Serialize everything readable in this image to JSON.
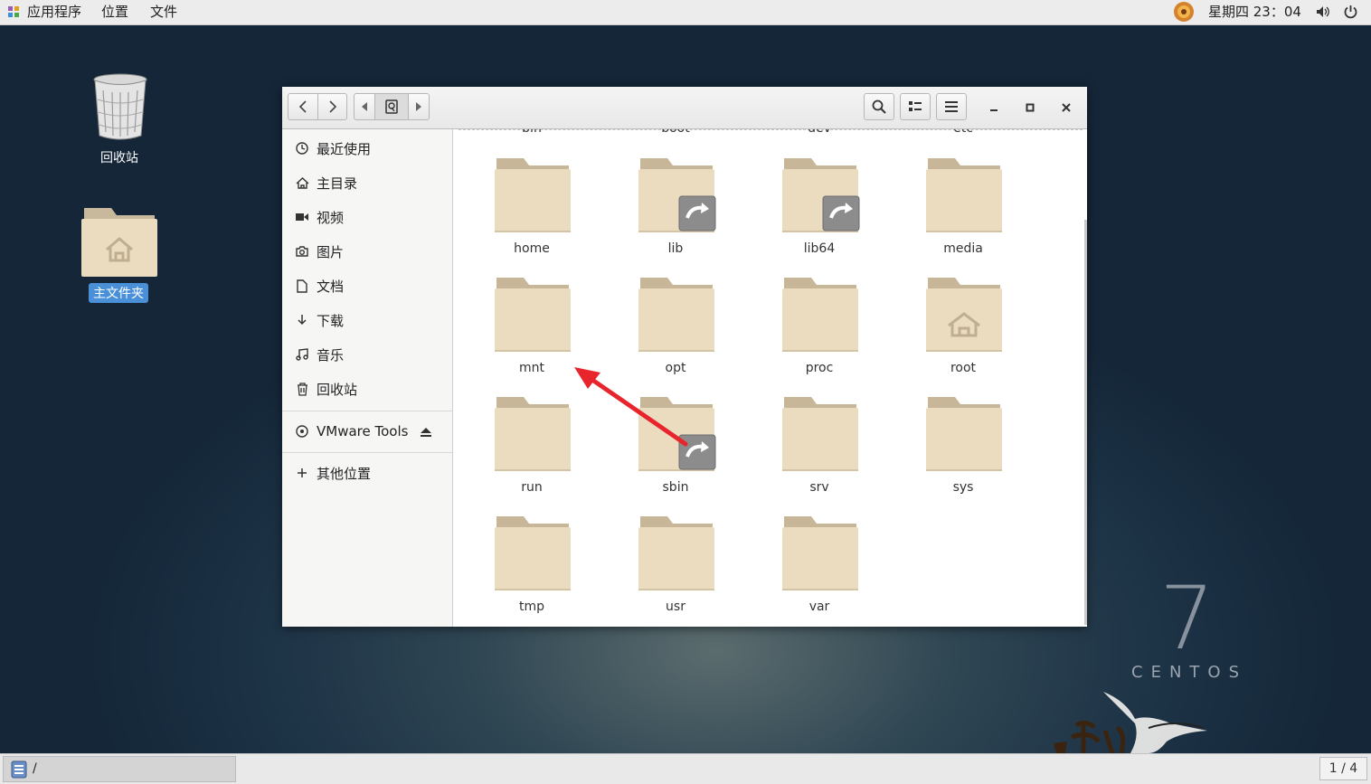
{
  "topbar": {
    "menus": [
      "应用程序",
      "位置",
      "文件"
    ],
    "clock": "星期四 23：04"
  },
  "desktop": {
    "icons": [
      {
        "label": "回收站",
        "icon": "trash-icon"
      },
      {
        "label": "主文件夹",
        "icon": "home-folder-icon",
        "selected": true
      }
    ],
    "branding": {
      "number": "7",
      "word": "CENTOS"
    }
  },
  "window": {
    "sidebar": {
      "items": [
        {
          "label": "最近使用",
          "icon": "recent-icon"
        },
        {
          "label": "主目录",
          "icon": "home-icon"
        },
        {
          "label": "视频",
          "icon": "video-icon"
        },
        {
          "label": "图片",
          "icon": "camera-icon"
        },
        {
          "label": "文档",
          "icon": "document-icon"
        },
        {
          "label": "下载",
          "icon": "download-icon"
        },
        {
          "label": "音乐",
          "icon": "music-icon"
        },
        {
          "label": "回收站",
          "icon": "trash-icon"
        }
      ],
      "device": {
        "label": "VMware Tools",
        "icon": "disc-icon",
        "eject_icon": "eject-icon"
      },
      "other": {
        "label": "其他位置",
        "icon": "plus-icon"
      }
    },
    "content": {
      "cut_off_row": [
        "bin",
        "boot",
        "dev",
        "etc"
      ],
      "items": [
        {
          "name": "home",
          "type": "folder"
        },
        {
          "name": "lib",
          "type": "symlink"
        },
        {
          "name": "lib64",
          "type": "symlink"
        },
        {
          "name": "media",
          "type": "folder"
        },
        {
          "name": "mnt",
          "type": "folder"
        },
        {
          "name": "opt",
          "type": "folder"
        },
        {
          "name": "proc",
          "type": "folder"
        },
        {
          "name": "root",
          "type": "home-folder"
        },
        {
          "name": "run",
          "type": "folder"
        },
        {
          "name": "sbin",
          "type": "symlink"
        },
        {
          "name": "srv",
          "type": "folder"
        },
        {
          "name": "sys",
          "type": "folder"
        },
        {
          "name": "tmp",
          "type": "folder"
        },
        {
          "name": "usr",
          "type": "folder"
        },
        {
          "name": "var",
          "type": "folder"
        }
      ]
    },
    "annotation": {
      "arrow_color": "#e8242c",
      "points_to": "mnt"
    }
  },
  "bottombar": {
    "task": "/",
    "workspace": "1 / 4"
  }
}
